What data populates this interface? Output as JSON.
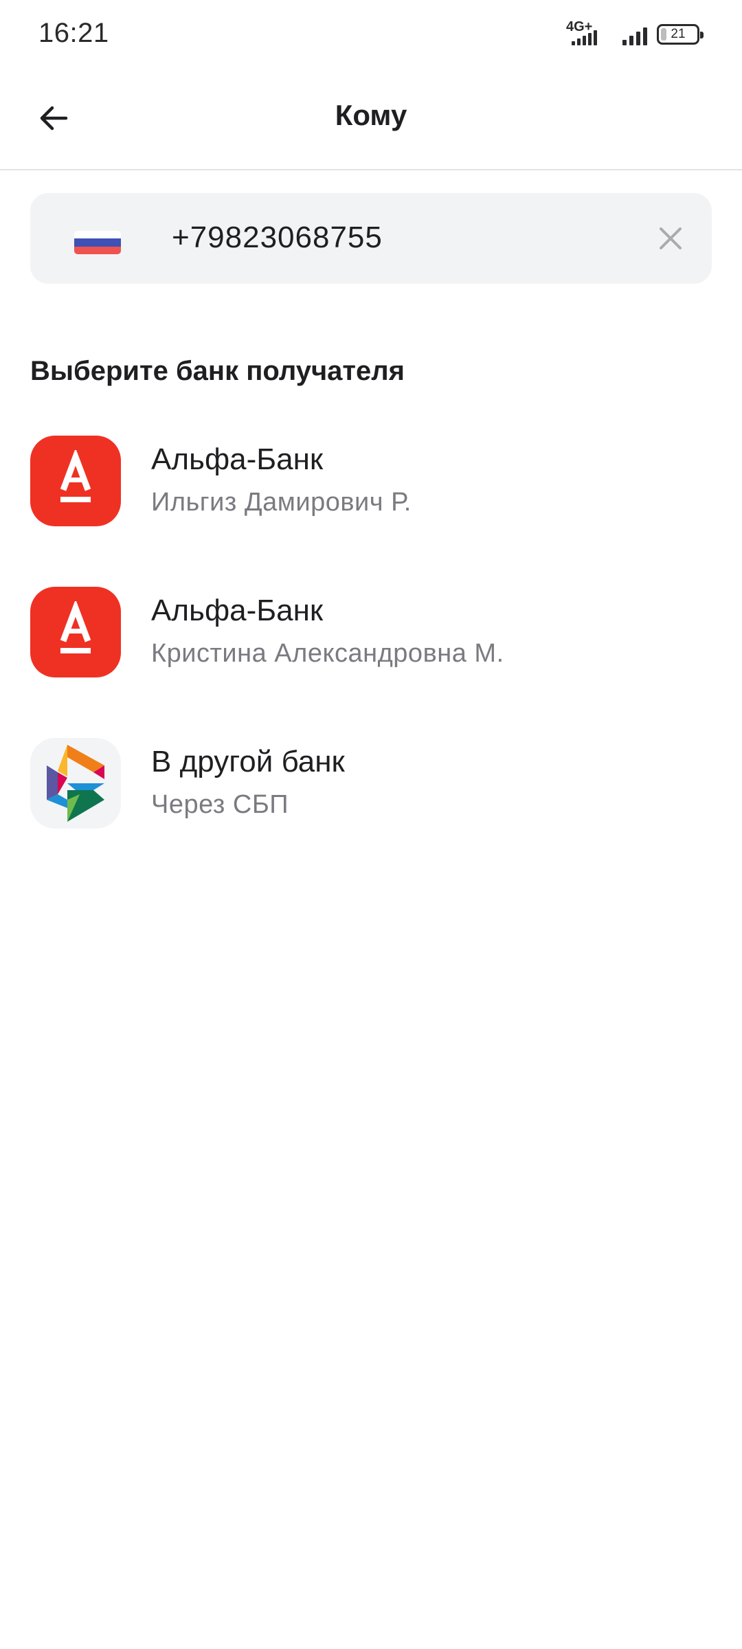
{
  "status_bar": {
    "time": "16:21",
    "network": "4G+",
    "battery": "21"
  },
  "header": {
    "title": "Кому"
  },
  "phone_field": {
    "value": "+79823068755",
    "flag_colors": [
      "#ffffff",
      "#3f51b5",
      "#ef5350"
    ]
  },
  "section": {
    "title": "Выберите банк получателя"
  },
  "banks": [
    {
      "name": "Альфа-Банк",
      "subtitle": "Ильгиз Дамирович Р.",
      "logo": "alfa-bank-logo",
      "color": "#ef3124"
    },
    {
      "name": "Альфа-Банк",
      "subtitle": "Кристина Александровна М.",
      "logo": "alfa-bank-logo",
      "color": "#ef3124"
    },
    {
      "name": "В другой банк",
      "subtitle": "Через СБП",
      "logo": "sbp-logo",
      "color": "#f3f4f6"
    }
  ]
}
